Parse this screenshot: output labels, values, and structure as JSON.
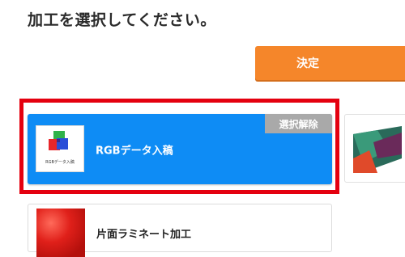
{
  "page": {
    "title": "加工を選択してください。",
    "confirm_label": "決定"
  },
  "options": [
    {
      "label": "RGBデータ入稿",
      "thumb_caption": "RGBデータ入稿",
      "selected": true,
      "deselect_label": "選択解除",
      "accent": "#0e8cf5"
    },
    {
      "label": "片面ラミネート加工",
      "selected": false
    }
  ],
  "colors": {
    "confirm": "#f5862a",
    "selected_border": "#e4000f",
    "badge": "#a9a9a9"
  }
}
